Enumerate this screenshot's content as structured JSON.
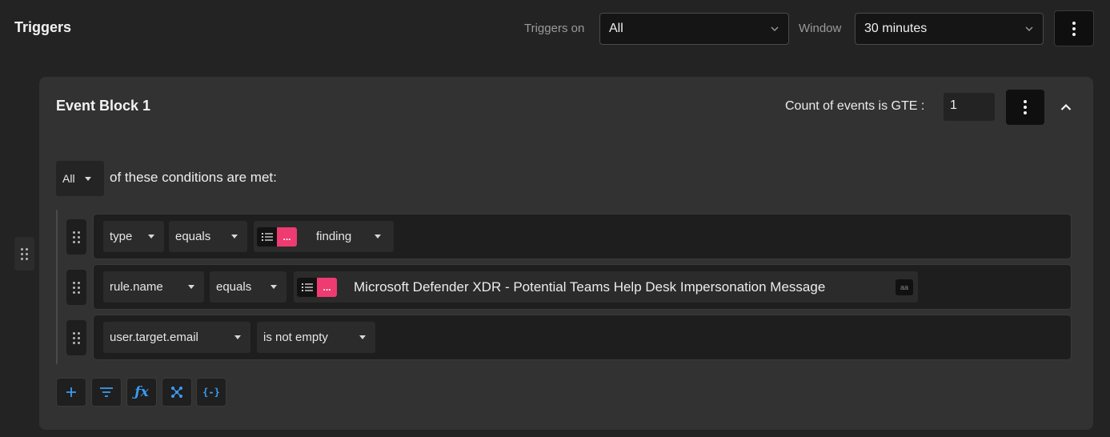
{
  "header": {
    "title": "Triggers",
    "triggers_on_label": "Triggers on",
    "triggers_on_value": "All",
    "window_label": "Window",
    "window_value": "30 minutes"
  },
  "event_block": {
    "title": "Event Block 1",
    "count_label": "Count of events is GTE :",
    "count_value": "1",
    "match_mode": "All",
    "conditions_text": "of these conditions are met:",
    "conditions": [
      {
        "field": "type",
        "operator": "equals",
        "value_badge": "...",
        "value": "finding"
      },
      {
        "field": "rule.name",
        "operator": "equals",
        "value_badge": "...",
        "value": "Microsoft Defender XDR - Potential Teams Help Desk Impersonation Message",
        "value_case_badge": "aa"
      },
      {
        "field": "user.target.email",
        "operator": "is not empty"
      }
    ]
  },
  "toolbar": {
    "buttons": [
      "plus-icon",
      "filter-icon",
      "function-icon",
      "network-icon",
      "variable-icon"
    ]
  },
  "colors": {
    "background": "#232323",
    "panel": "#333233",
    "accent_pink": "#ee3b72",
    "accent_blue": "#3b9cf0"
  }
}
